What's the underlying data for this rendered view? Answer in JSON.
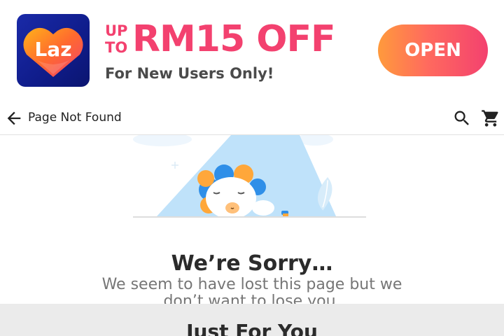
{
  "banner": {
    "logo_text": "Laz",
    "promo_prefix_line1": "UP",
    "promo_prefix_line2": "TO",
    "promo_amount": "RM15 OFF",
    "promo_subtitle": "For New Users Only!",
    "open_label": "OPEN",
    "colors": {
      "brand_pink": "#f3416f",
      "brand_orange": "#ff9a3c",
      "logo_navy": "#0f1c8a"
    }
  },
  "appbar": {
    "back_icon": "arrow-back-icon",
    "title": "Page Not Found",
    "search_icon": "search-icon",
    "cart_icon": "shopping-cart-icon"
  },
  "illustration": {
    "subject": "sleeping-lion-mascot-under-spotlight"
  },
  "message": {
    "title": "We’re Sorry…",
    "body": "We seem to have lost this page but we don’t want to lose you."
  },
  "recommendations": {
    "title": "Just For You"
  }
}
